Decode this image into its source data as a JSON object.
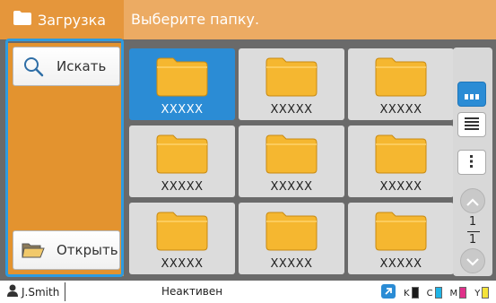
{
  "header": {
    "title": "Загрузка",
    "subtitle": "Выберите папку."
  },
  "sidebar": {
    "search_label": "Искать",
    "open_label": "Открыть"
  },
  "folders": [
    {
      "label": "XXXXX",
      "selected": true
    },
    {
      "label": "XXXXX",
      "selected": false
    },
    {
      "label": "XXXXX",
      "selected": false
    },
    {
      "label": "XXXXX",
      "selected": false
    },
    {
      "label": "XXXXX",
      "selected": false
    },
    {
      "label": "XXXXX",
      "selected": false
    },
    {
      "label": "XXXXX",
      "selected": false
    },
    {
      "label": "XXXXX",
      "selected": false
    },
    {
      "label": "XXXXX",
      "selected": false
    }
  ],
  "pagination": {
    "current": "1",
    "total": "1"
  },
  "status_bar": {
    "user": "J.Smith",
    "status": "Неактивен",
    "inks": [
      {
        "label": "K",
        "color": "#1a1a1a"
      },
      {
        "label": "C",
        "color": "#1fb4e6"
      },
      {
        "label": "M",
        "color": "#e0308a"
      },
      {
        "label": "Y",
        "color": "#f5e33a"
      }
    ]
  },
  "colors": {
    "header_bg": "#ecab63",
    "header_left_bg": "#e5963b",
    "sidebar_bg": "#e3932f",
    "selection": "#2b8cd5",
    "highlight_border": "#2e9be0",
    "folder_fill": "#f5b730"
  },
  "icons": {
    "header": "folder-icon",
    "search": "magnifier-icon",
    "open": "open-folder-icon",
    "view_thumbnail": "thumbnail-view-icon",
    "view_list": "list-view-icon",
    "menu": "more-vertical-icon",
    "page_up": "chevron-up-icon",
    "page_down": "chevron-down-icon",
    "user": "user-icon",
    "connection": "connection-icon"
  }
}
